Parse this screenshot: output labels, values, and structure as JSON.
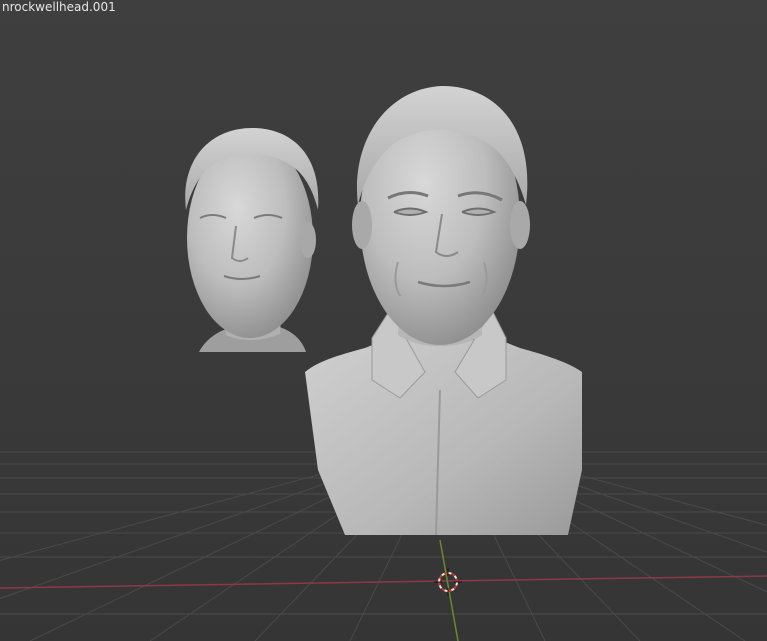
{
  "app": {
    "object_label": "nrockwellhead.001"
  },
  "colors": {
    "viewport_bg": "#3b3b3b",
    "grid_line": "#4a4a4a",
    "x_axis": "#8a3a46",
    "y_axis": "#6b8a2a",
    "mesh_gray": "#bdbdbd"
  },
  "icons": {
    "cursor": "3d-cursor-icon"
  }
}
